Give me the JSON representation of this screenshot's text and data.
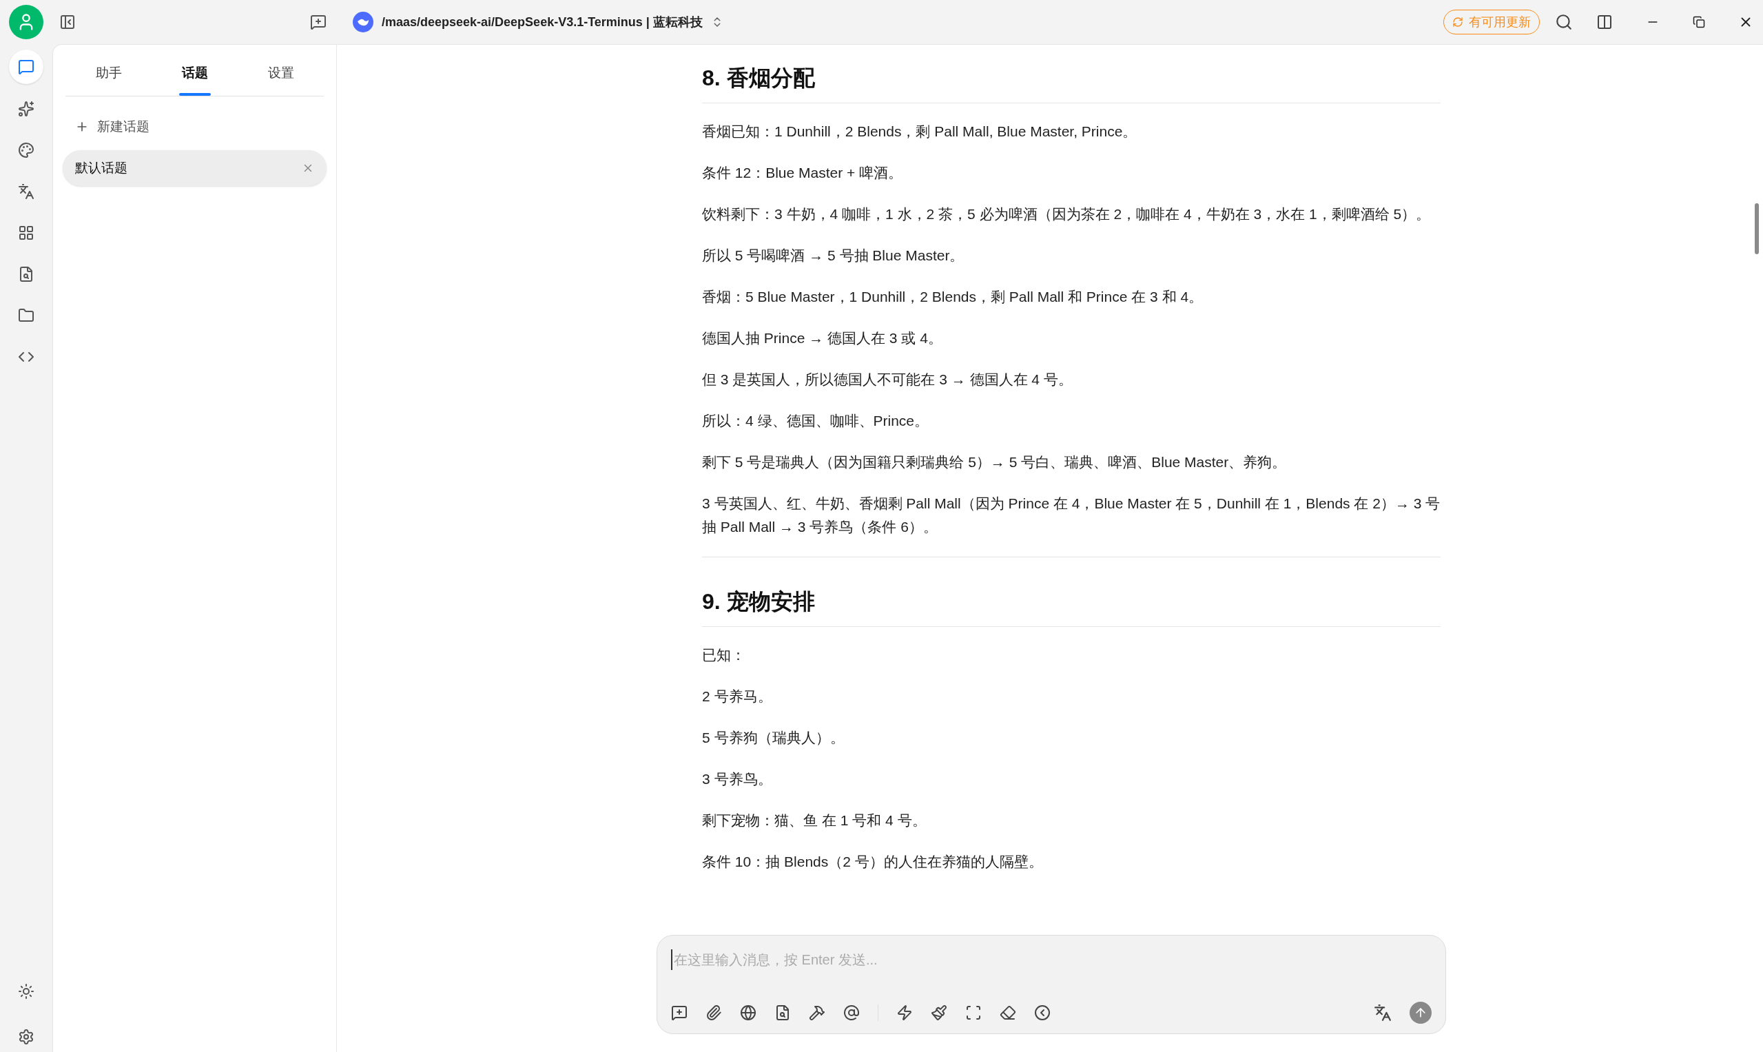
{
  "rail": [
    {
      "selected": true
    },
    {
      "selected": false
    },
    {
      "selected": false
    },
    {
      "selected": false
    },
    {
      "selected": false
    },
    {
      "selected": false
    },
    {
      "selected": false
    },
    {
      "selected": false
    }
  ],
  "model": {
    "path": "/maas/deepseek-ai/DeepSeek-V3.1-Terminus | 蓝耘科技"
  },
  "update_badge": "有可用更新",
  "tabs": [
    {
      "label": "助手",
      "selected": false
    },
    {
      "label": "话题",
      "selected": true
    },
    {
      "label": "设置",
      "selected": false
    }
  ],
  "new_topic": "新建话题",
  "topics": [
    {
      "label": "默认话题",
      "selected": true
    }
  ],
  "blocks": [
    {
      "kind": "heading",
      "text": "8. 香烟分配"
    },
    {
      "kind": "paragraph",
      "text": "香烟已知：1 Dunhill，2 Blends，剩 Pall Mall, Blue Master, Prince。"
    },
    {
      "kind": "paragraph",
      "text": "条件 12：Blue Master + 啤酒。"
    },
    {
      "kind": "paragraph",
      "text": "饮料剩下：3 牛奶，4 咖啡，1 水，2 茶，5 必为啤酒（因为茶在 2，咖啡在 4，牛奶在 3，水在 1，剩啤酒给 5）。"
    },
    {
      "kind": "paragraph",
      "text": "所以 5 号喝啤酒 → 5 号抽 Blue Master。"
    },
    {
      "kind": "paragraph",
      "text": "香烟：5 Blue Master，1 Dunhill，2 Blends，剩 Pall Mall 和 Prince 在 3 和 4。"
    },
    {
      "kind": "paragraph",
      "text": "德国人抽 Prince → 德国人在 3 或 4。"
    },
    {
      "kind": "paragraph",
      "text": "但 3 是英国人，所以德国人不可能在 3 → 德国人在 4 号。"
    },
    {
      "kind": "paragraph",
      "text": "所以：4 绿、德国、咖啡、Prince。"
    },
    {
      "kind": "paragraph",
      "text": "剩下 5 号是瑞典人（因为国籍只剩瑞典给 5）→ 5 号白、瑞典、啤酒、Blue Master、养狗。"
    },
    {
      "kind": "paragraph",
      "text": "3 号英国人、红、牛奶、香烟剩 Pall Mall（因为 Prince 在 4，Blue Master 在 5，Dunhill 在 1，Blends 在 2）→ 3 号抽 Pall Mall → 3 号养鸟（条件 6）。"
    },
    {
      "kind": "rule"
    },
    {
      "kind": "heading",
      "text": "9. 宠物安排"
    },
    {
      "kind": "paragraph",
      "text": "已知："
    },
    {
      "kind": "paragraph",
      "text": "2 号养马。"
    },
    {
      "kind": "paragraph",
      "text": "5 号养狗（瑞典人）。"
    },
    {
      "kind": "paragraph",
      "text": "3 号养鸟。"
    },
    {
      "kind": "paragraph",
      "text": "剩下宠物：猫、鱼 在 1 号和 4 号。"
    },
    {
      "kind": "paragraph",
      "text": "条件 10：抽 Blends（2 号）的人住在养猫的人隔壁。"
    }
  ],
  "composer": {
    "placeholder": "在这里输入消息，按 Enter 发送..."
  }
}
